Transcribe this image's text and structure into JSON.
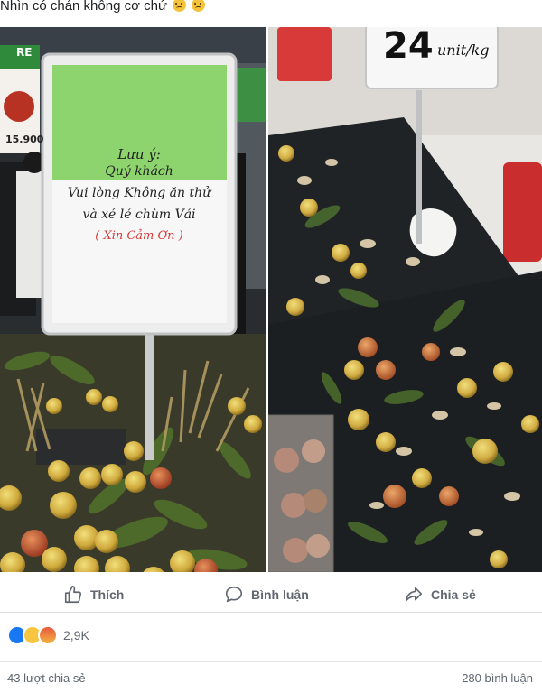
{
  "post": {
    "caption": "Nhìn có chán không cơ chứ"
  },
  "photo_left": {
    "sign": {
      "note": "Lưu ý:",
      "line1": "Quý khách",
      "line2": "Vui lòng Không ăn thử",
      "line3": "và xé lẻ chùm Vải",
      "line4": "( Xin Cảm Ơn )"
    },
    "promo_badge": "RE",
    "promo_price": "15.900"
  },
  "photo_right": {
    "price_sign": {
      "price": "24",
      "unit": "unit/kg"
    }
  },
  "actions": {
    "like": "Thích",
    "comment": "Bình luận",
    "share": "Chia sẻ"
  },
  "stats": {
    "reaction_count": "2,9K",
    "shares": "43 lượt chia sẻ",
    "comments": "280 bình luận"
  },
  "colors": {
    "facebook_blue": "#1877f2",
    "action_gray": "#606770"
  }
}
